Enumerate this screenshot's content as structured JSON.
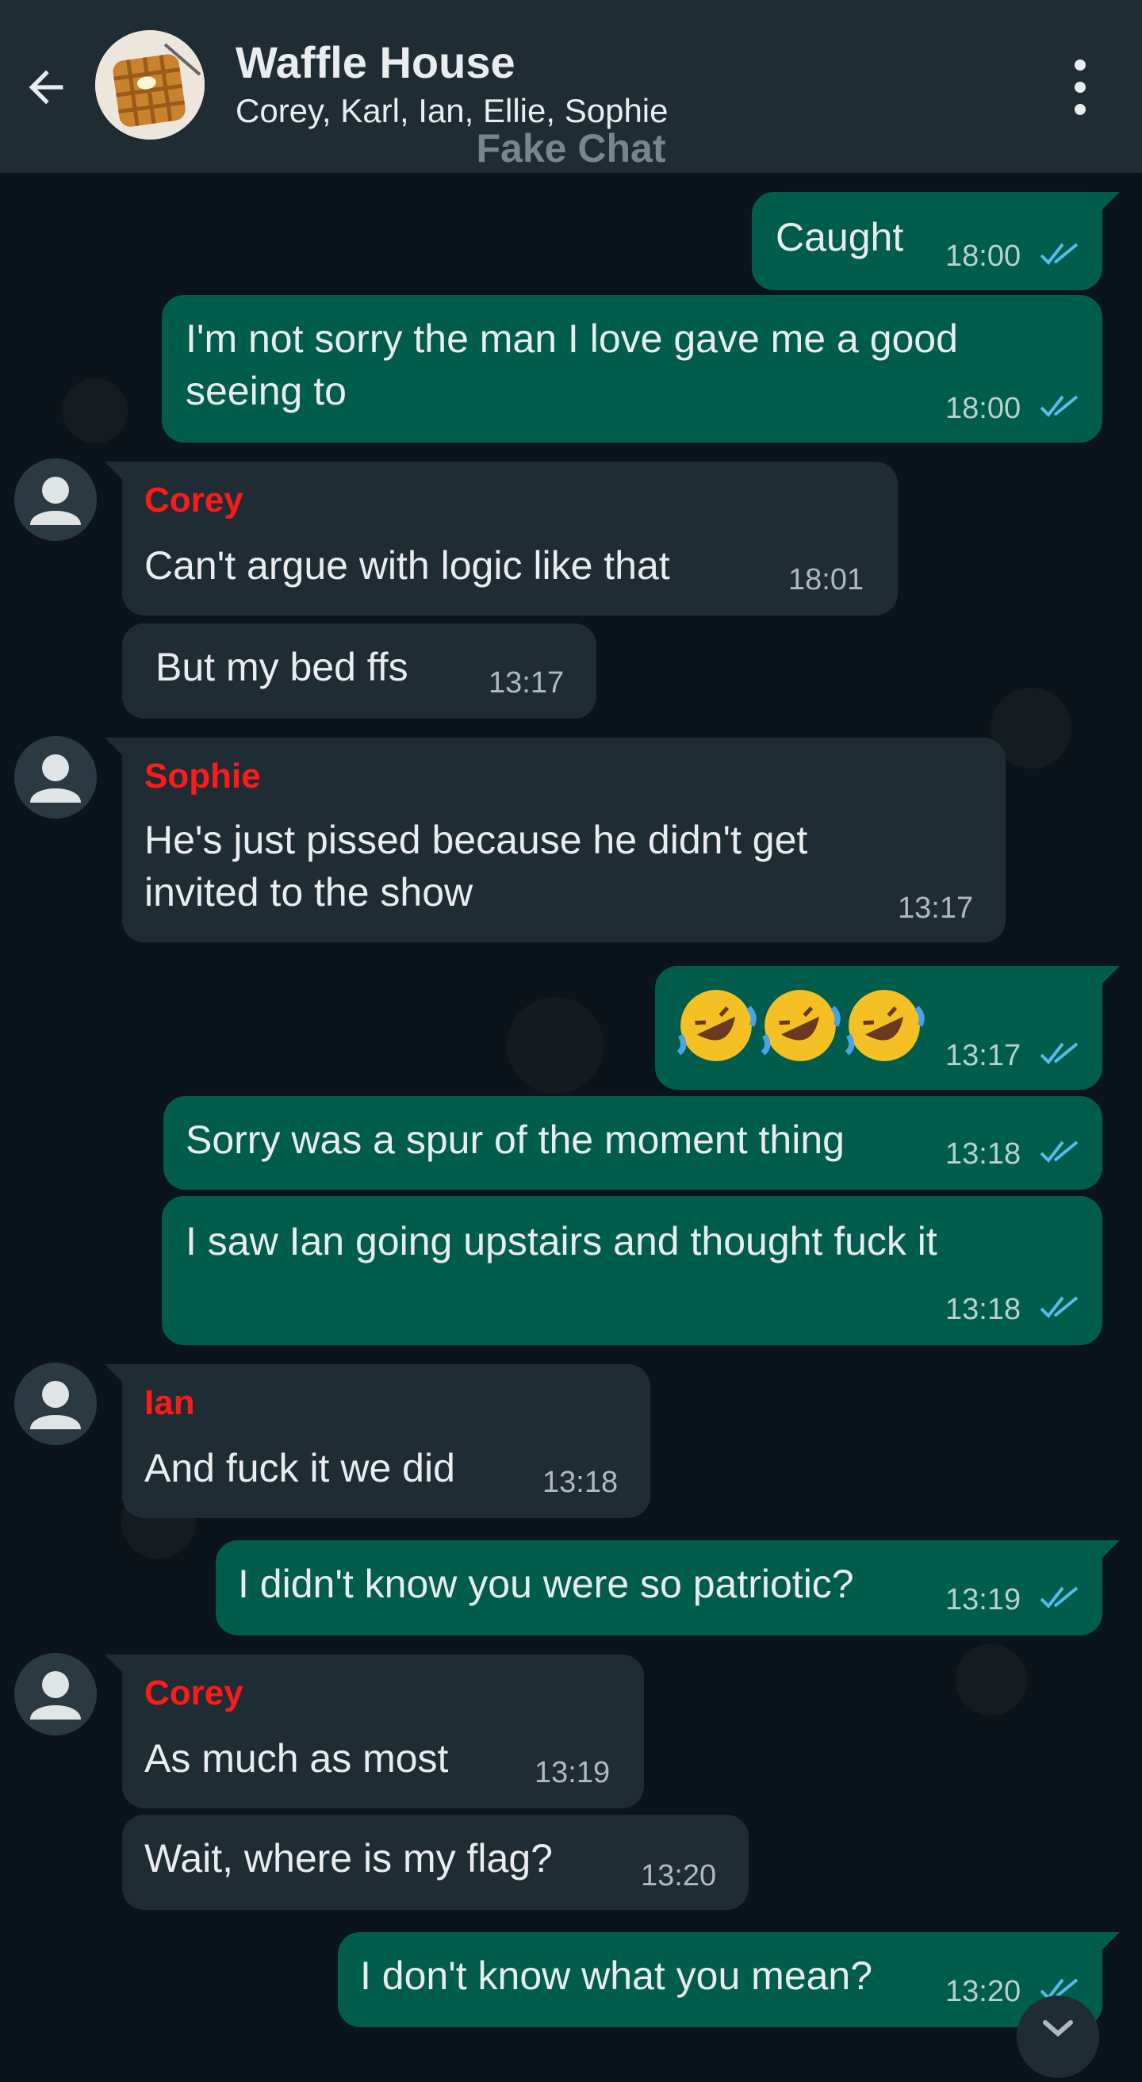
{
  "header": {
    "title": "Waffle House",
    "members": "Corey, Karl, Ian, Ellie, Sophie",
    "watermark": "Fake Chat"
  },
  "messages": [
    {
      "dir": "out",
      "text": "Caught",
      "time": "18:00",
      "status": "read"
    },
    {
      "dir": "out",
      "text_lines": [
        "I'm not sorry the man I love gave me a good",
        "seeing to"
      ],
      "time": "18:00",
      "status": "read"
    },
    {
      "dir": "in",
      "sender": "Corey",
      "text": "Can't argue with logic like that",
      "time": "18:01"
    },
    {
      "dir": "in",
      "text": "But my bed ffs",
      "time": "13:17"
    },
    {
      "dir": "in",
      "sender": "Sophie",
      "text_lines": [
        "He's just pissed because he didn't get",
        "invited to the show"
      ],
      "time": "13:17"
    },
    {
      "dir": "out",
      "emoji": "rolling-on-floor-laughing x3",
      "time": "13:17",
      "status": "read"
    },
    {
      "dir": "out",
      "text": "Sorry was a spur of the moment thing",
      "time": "13:18",
      "status": "read"
    },
    {
      "dir": "out",
      "text": "I saw Ian going upstairs and thought fuck it",
      "time": "13:18",
      "status": "read"
    },
    {
      "dir": "in",
      "sender": "Ian",
      "text": "And fuck it we did",
      "time": "13:18"
    },
    {
      "dir": "out",
      "text": "I didn't know you were so patriotic?",
      "time": "13:19",
      "status": "read"
    },
    {
      "dir": "in",
      "sender": "Corey",
      "text": "As much as most",
      "time": "13:19"
    },
    {
      "dir": "in",
      "text": "Wait, where is my flag?",
      "time": "13:20"
    },
    {
      "dir": "out",
      "text": "I don't know what you mean?",
      "time": "13:20",
      "status": "read"
    }
  ],
  "colors": {
    "header_bg": "#1f2c34",
    "chat_bg": "#0b141a",
    "outgoing_bubble": "#005c4b",
    "incoming_bubble": "#202c33",
    "sender_name": "#ff1a1a",
    "read_ticks": "#53bdeb"
  },
  "icons": [
    "back-arrow-icon",
    "group-avatar-waffle",
    "more-vert-icon",
    "default-avatar-icon",
    "double-check-icon",
    "chevron-down-icon"
  ]
}
